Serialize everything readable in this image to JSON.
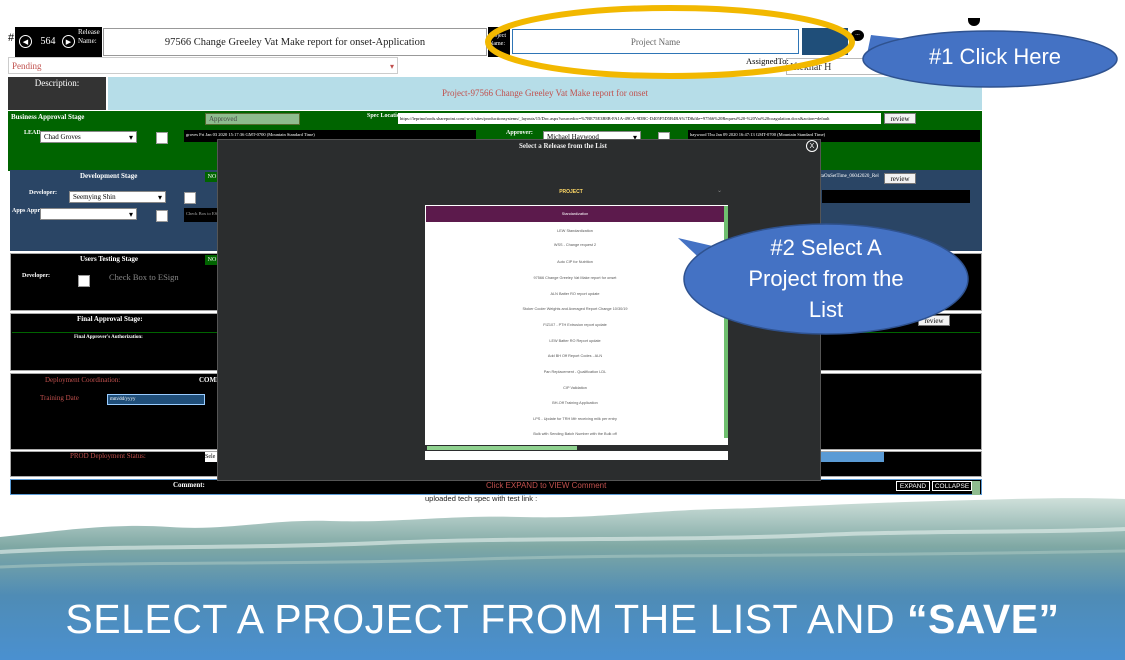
{
  "header": {
    "release_number": "564",
    "release_name_label": "Release Name:",
    "release_name": "97566 Change Greeley Vat Make report for onset-Application",
    "project_name_label": "Project Name:",
    "project_name_placeholder": "Project Name",
    "status": "Pending",
    "assigned_to_label": "AssignedTo:",
    "assigned_to": "Iftekhar H",
    "description_label": "Description:",
    "description": "Project-97566 Change Greeley Vat Make report for onset"
  },
  "business": {
    "title": "Business Approval Stage",
    "status": "Approved",
    "spec_label": "Spec Location:",
    "spec_url": "https://leprinofoods.sharepoint.com/:w:/r/sites/productionsystems/_layouts/15/Doc.aspx?sourcedoc=%7BE75E3B8B-FA1A-49CA-9DBC-D405F5D5B4BA%7D&file=97566%20Request%20-%20Vat%20coagulation.docx&action=default",
    "review_btn": "review",
    "lead_label": "LEAD:",
    "lead": "Chad Groves",
    "lead_note": "groves Fri Jan 03 2020 15:17:36 GMT-0700 (Mountain Standard Time)",
    "approver_label": "Approver:",
    "approver": "Michael Haywood",
    "approver_note": "haywood Thu Jan 09 2020 16:47:13 GMT-0700 (Mountain Standard Time)"
  },
  "development": {
    "title": "Development Stage",
    "status_short": "NO",
    "developer_label": "Developer:",
    "developer": "Seemying Shin",
    "apps_label": "Apps Appr:",
    "checkbox_label": "Check Box to ESign",
    "file_ref": "ttaOnSetTime_06042020_Rel",
    "review_btn": "review"
  },
  "users_testing": {
    "title": "Users Testing Stage",
    "status_short": "NO",
    "developer_label": "Developer:",
    "checkbox_label": "Check Box to ESign"
  },
  "final_approval": {
    "title": "Final Approval Stage:",
    "authorization_label": "Final Approver's Authorization:",
    "review_btn": "review"
  },
  "deployment": {
    "title": "Deployment Coordination:",
    "comm_label": "COMM",
    "training_label": "Training Date",
    "training_placeholder": "mm/dd/yyyy",
    "prod_label": "PROD Deployment Status:",
    "prod_value": "Sele"
  },
  "comment": {
    "label": "Comment:",
    "hint": "Click EXPAND to VIEW Comment",
    "expand_btn": "EXPAND",
    "collapse_btn": "COLLAPSE",
    "text": "uploaded tech spec with test link :"
  },
  "modal": {
    "title": "Select a Release from the List",
    "close": "X",
    "column_header": "PROJECT",
    "items": [
      "Standardization",
      "LEW Standardization",
      "WSS - Change request 2",
      "Auto CIP for Nutrition",
      "97566 Change Greeley Vat Make report for onset",
      "ALN Batter RO report update",
      "Stoker Cooler Weights and Averaged Report Change 10/30/19",
      "FIZ107 - PTH Extrusion report update",
      "LEW Batter RO Report update",
      "Add BH Off Report Codes - ALN",
      "Pan Replacement - Qualification LDL",
      "CIP Validation",
      "BH-Off Training Application",
      "LPS - Update for TRH Mfr receiving milk per entry",
      "Bulk with Sending Batch Number with the Bulk off"
    ]
  },
  "callouts": {
    "callout1": "#1 Click Here",
    "callout2": "#2 Select A Project from the List"
  },
  "banner": {
    "text_main": "SELECT A PROJECT FROM THE LIST AND ",
    "text_bold": "“SAVE”"
  },
  "colors": {
    "approval_green": "#006400",
    "dev_blue": "#2a4565",
    "dark_black": "#000000",
    "modal_bg": "#2b2d2e",
    "selected_purple": "#5c1a4c",
    "callout_fill": "#4472c4",
    "ring_yellow": "#f2b800",
    "desc_teal": "#b6dde8",
    "header_navy": "#1f4e79"
  }
}
